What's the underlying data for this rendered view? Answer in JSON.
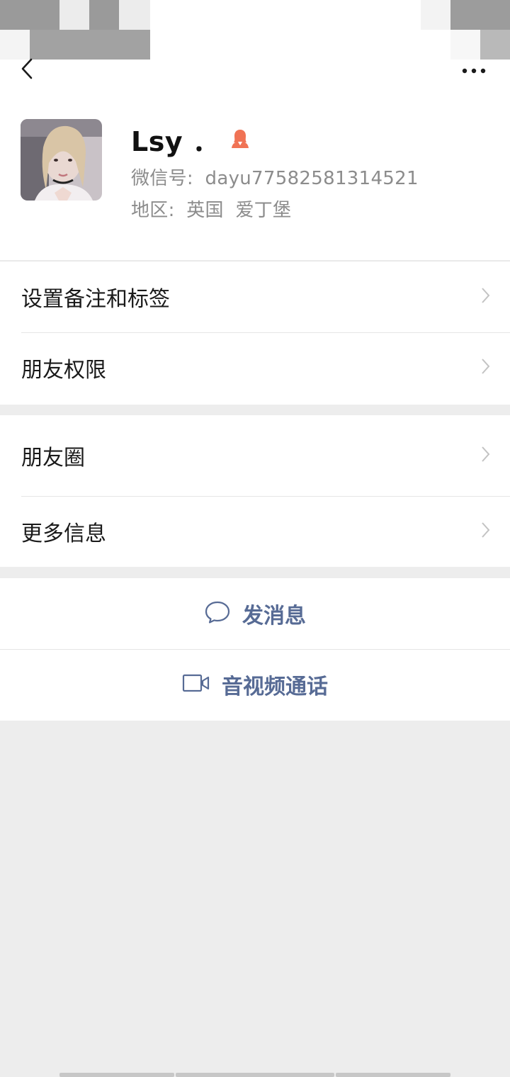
{
  "profile": {
    "name": "Lsy ．",
    "wechat_id_label": "微信号:",
    "wechat_id": "dayu77582581314521",
    "region_label": "地区:",
    "region_country": "英国",
    "region_city": "爱丁堡",
    "gender": "female"
  },
  "menu": {
    "section1": [
      {
        "label": "设置备注和标签"
      },
      {
        "label": "朋友权限"
      }
    ],
    "section2": [
      {
        "label": "朋友圈"
      },
      {
        "label": "更多信息"
      }
    ]
  },
  "actions": {
    "send_message": "发消息",
    "video_call": "音视频通话"
  },
  "colors": {
    "link_blue": "#576b95",
    "gender_female": "#f07355",
    "page_bg": "#ededed"
  },
  "icons": {
    "back": "chevron-left-icon",
    "more": "more-dots-icon",
    "message": "chat-bubble-icon",
    "video": "video-camera-icon",
    "row_arrow": "chevron-right-icon"
  }
}
